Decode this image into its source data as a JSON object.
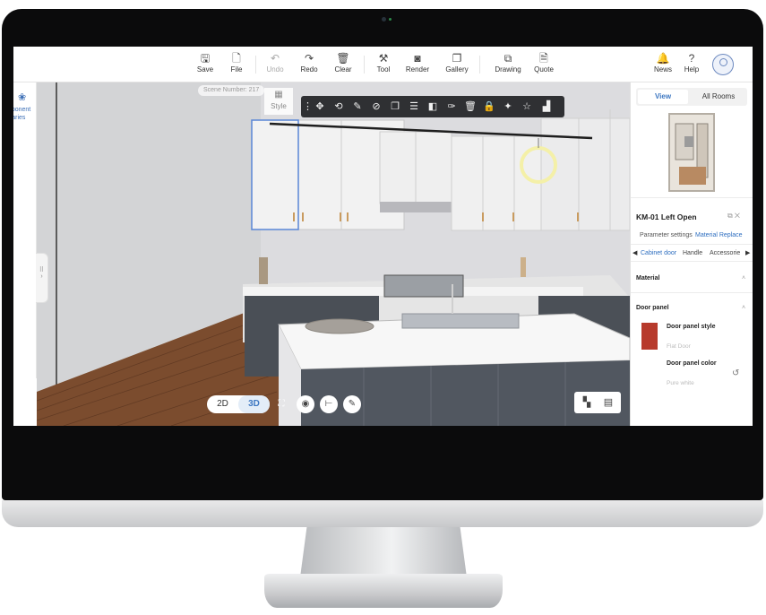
{
  "toolbar": {
    "items": [
      {
        "label": "Save",
        "icon": "save-icon",
        "glyph": "🖫"
      },
      {
        "label": "File",
        "icon": "file-icon",
        "glyph": "🗋"
      },
      {
        "label": "Undo",
        "icon": "undo-icon",
        "glyph": "↶"
      },
      {
        "label": "Redo",
        "icon": "redo-icon",
        "glyph": "↷"
      },
      {
        "label": "Clear",
        "icon": "trash-icon",
        "glyph": "🗑"
      },
      {
        "label": "Tool",
        "icon": "tool-icon",
        "glyph": "⚒"
      },
      {
        "label": "Render",
        "icon": "render-icon",
        "glyph": "◙"
      },
      {
        "label": "Gallery",
        "icon": "gallery-icon",
        "glyph": "❐"
      },
      {
        "label": "Drawing",
        "icon": "drawing-icon",
        "glyph": "⧉"
      },
      {
        "label": "Quote",
        "icon": "quote-icon",
        "glyph": "🗎"
      },
      {
        "label": "News",
        "icon": "bell-icon",
        "glyph": "🔔"
      },
      {
        "label": "Help",
        "icon": "help-icon",
        "glyph": "?"
      }
    ]
  },
  "left_panel": {
    "label": "mponent\nbraries"
  },
  "viewport": {
    "scene_number": "Scene Number: 217",
    "style_label": "Style",
    "view_modes": [
      "2D",
      "3D"
    ],
    "active_view": "3D"
  },
  "object_toolbar": {
    "tools": [
      "drag-handle-icon",
      "move-icon",
      "rotate-icon",
      "edit-icon",
      "hide-icon",
      "copy-icon",
      "align-icon",
      "mirror-icon",
      "paint-icon",
      "delete-icon",
      "lock-icon",
      "magic-icon",
      "favorite-icon",
      "material-icon"
    ]
  },
  "right_panel": {
    "tabs": [
      "View",
      "All Rooms"
    ],
    "active_tab": "View",
    "item_title": "KM-01 Left Open",
    "sub_tabs": [
      "Parameter settings",
      "Material Replace"
    ],
    "active_sub_tab": "Material Replace",
    "categories": [
      "Cabinet door",
      "Handle",
      "Accessorie"
    ],
    "active_category": "Cabinet door",
    "material_label": "Material",
    "door_panel_label": "Door panel",
    "door_panel_style_label": "Door panel style",
    "door_panel_style_value": "Flat Door",
    "door_panel_color_label": "Door panel color",
    "door_panel_color_value": "Pure white",
    "swatch_color": "#b73a2c"
  },
  "colors": {
    "accent": "#3e78c2",
    "toolbar_dark": "#2f3033",
    "bezel": "#0b0b0c"
  }
}
